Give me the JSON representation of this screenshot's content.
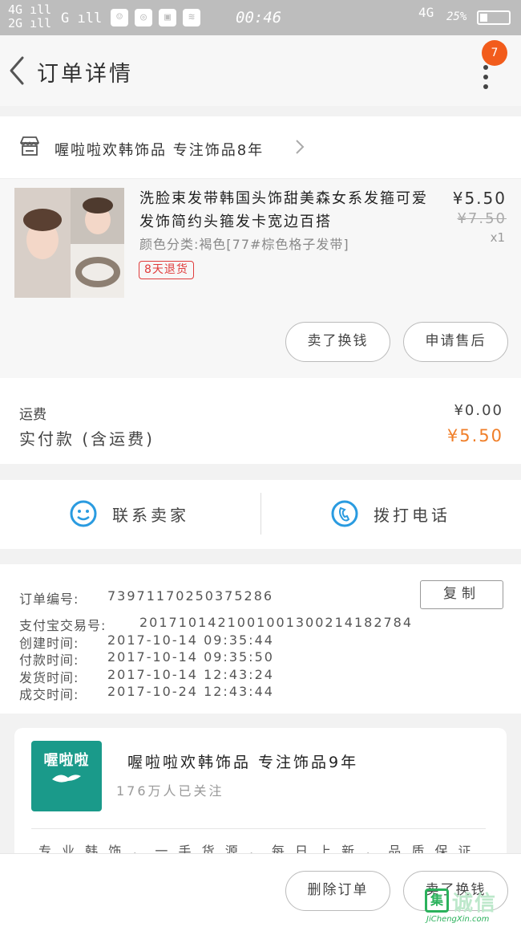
{
  "status_bar": {
    "network_1": "4G",
    "network_2": "2G",
    "network_3": "G",
    "time": "00:46",
    "network_right": "4G",
    "battery": "25%"
  },
  "header": {
    "title": "订单详情",
    "badge_count": "7"
  },
  "shop": {
    "name": "喔啦啦欢韩饰品 专注饰品8年"
  },
  "product": {
    "name": "洗脸束发带韩国头饰甜美森女系发箍可爱发饰简约头箍发卡宽边百搭",
    "attr": "颜色分类:褐色[77#棕色格子发带]",
    "tag": "8天退货",
    "price": "¥5.50",
    "original_price": "¥7.50",
    "qty": "x1",
    "btn_exchange": "卖了换钱",
    "btn_aftersale": "申请售后"
  },
  "fees": {
    "shipping_label": "运费",
    "shipping_value": "¥0.00",
    "paid_label": "实付款 (含运费)",
    "paid_value": "¥5.50",
    "accent_color": "#f07e28"
  },
  "contact": {
    "seller_label": "联系卖家",
    "phone_label": "拨打电话",
    "icon_color": "#2a9be0"
  },
  "order_info": {
    "copy_label": "复制",
    "lines": [
      {
        "label": "订单编号:",
        "value": "73971170250375286"
      },
      {
        "label": "支付宝交易号:",
        "value": "2017101421001001300214182784"
      },
      {
        "label": "创建时间:",
        "value": "2017-10-14 09:35:44"
      },
      {
        "label": "付款时间:",
        "value": "2017-10-14 09:35:50"
      },
      {
        "label": "发货时间:",
        "value": "2017-10-14 12:43:24"
      },
      {
        "label": "成交时间:",
        "value": "2017-10-24 12:43:44"
      }
    ]
  },
  "shop_card": {
    "logo_text": "喔啦啦",
    "name": "喔啦啦欢韩饰品 专注饰品9年",
    "followers": "176万人已关注",
    "desc": "专 业 韩 饰 ， 一 手 货 源 ， 每 日 上 新 ， 品 质 保 证"
  },
  "bottom_bar": {
    "delete_label": "删除订单",
    "exchange_label": "卖了换钱"
  },
  "watermark": {
    "box_text": "集",
    "text": "诚信",
    "url": "JiChengXin.com"
  }
}
